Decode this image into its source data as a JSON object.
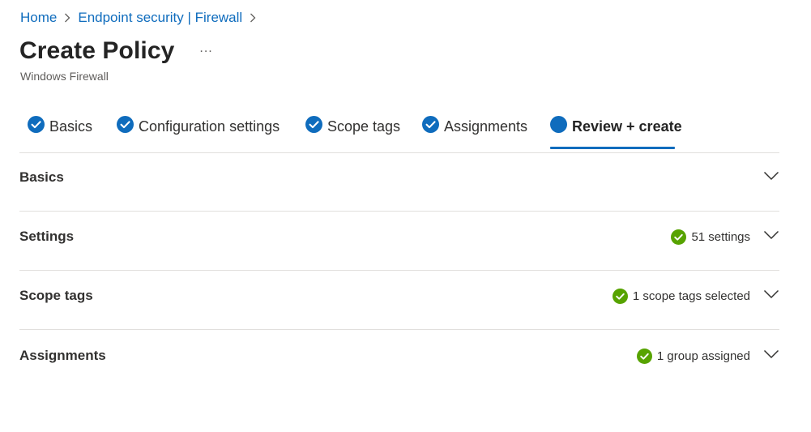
{
  "breadcrumb": {
    "home": "Home",
    "endpoint": "Endpoint security | Firewall"
  },
  "header": {
    "title": "Create Policy",
    "more": "...",
    "subtitle": "Windows Firewall"
  },
  "wizard": {
    "steps": [
      {
        "label": "Basics",
        "state": "completed"
      },
      {
        "label": "Configuration settings",
        "state": "completed"
      },
      {
        "label": "Scope tags",
        "state": "completed"
      },
      {
        "label": "Assignments",
        "state": "completed"
      },
      {
        "label": "Review + create",
        "state": "current"
      }
    ]
  },
  "sections": [
    {
      "name": "Basics",
      "status": ""
    },
    {
      "name": "Settings",
      "status": "51 settings"
    },
    {
      "name": "Scope tags",
      "status": "1 scope tags selected"
    },
    {
      "name": "Assignments",
      "status": "1 group assigned"
    }
  ],
  "colors": {
    "accent": "#0f6cbd",
    "success": "#57a300",
    "divider": "#e1dfdd"
  },
  "icons": {
    "step_done": "check-circle-icon",
    "step_current": "filled-circle-icon",
    "status_ok": "check-circle-icon",
    "expand": "chevron-down-icon",
    "breadcrumb_sep": "chevron-right-icon"
  }
}
